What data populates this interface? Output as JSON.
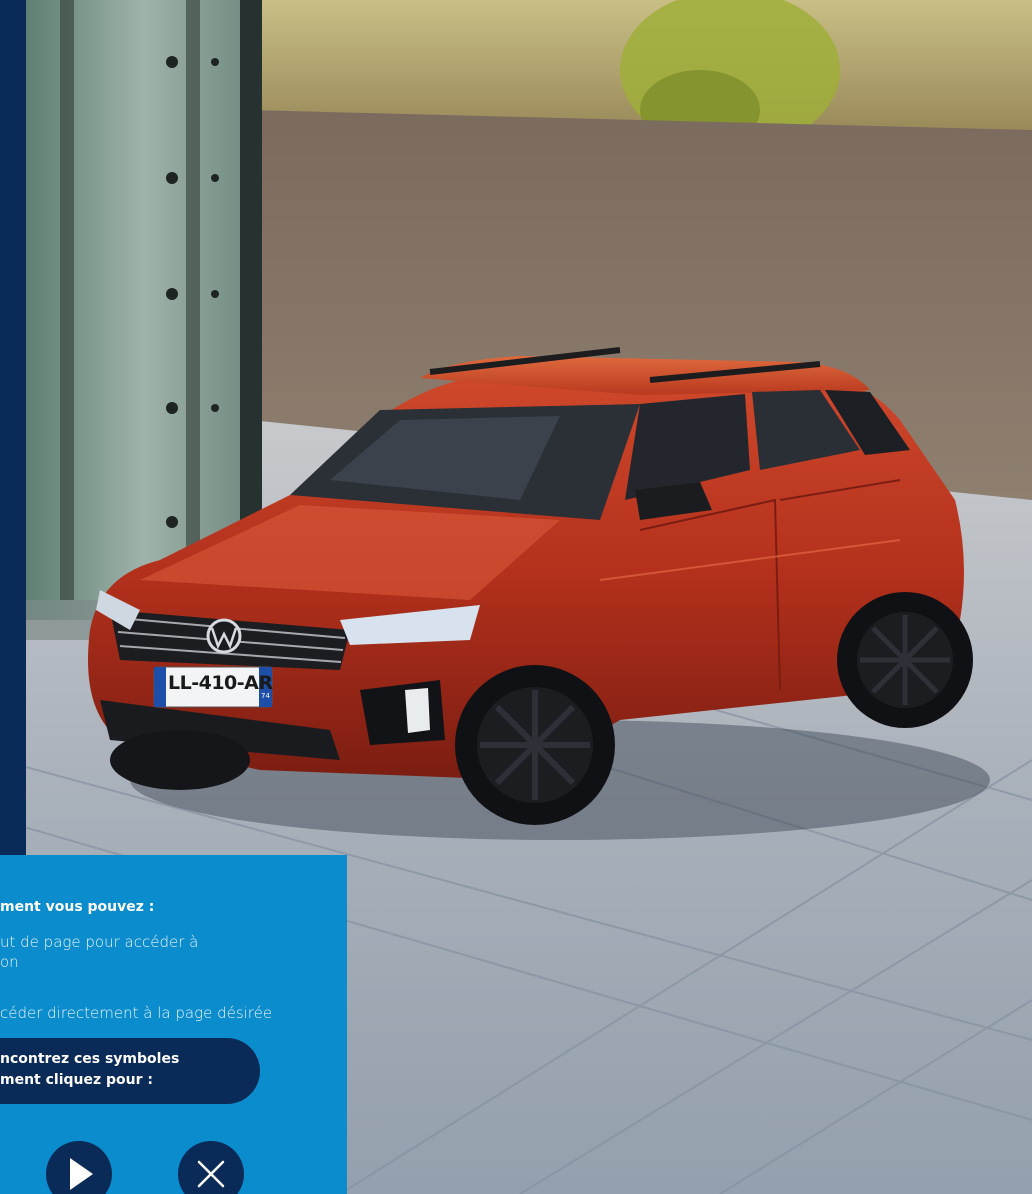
{
  "photo": {
    "subject": "car-photo",
    "license_plate": "LL-410-AR",
    "plate_region": "74"
  },
  "info_panel": {
    "heading": "ment vous pouvez :",
    "line1": "ut de page pour accéder à",
    "line2": "on",
    "line3": "céder directement à la page désirée",
    "symbols_line1": "ncontrez ces symboles",
    "symbols_line2": "ment cliquez pour :"
  },
  "buttons": {
    "play_icon": "play-icon",
    "close_icon": "close-icon"
  },
  "colors": {
    "navy": "#0a2a57",
    "panel_blue": "#0b8ccc",
    "car_red": "#b8321e"
  }
}
